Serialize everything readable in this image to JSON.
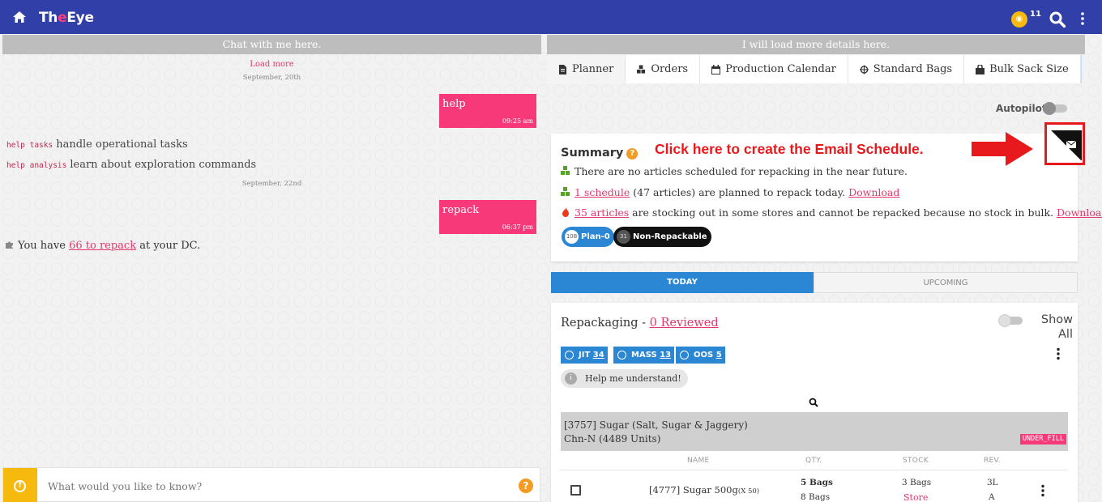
{
  "header": {
    "logo_pre": "Th",
    "logo_e": "e",
    "logo_post": "Eye",
    "coin_count": "11"
  },
  "chat": {
    "title": "Chat with me here.",
    "load_more": "Load more",
    "date1": "September, 20th",
    "msg1": {
      "text": "help",
      "time": "09:25 am"
    },
    "help_lines": [
      {
        "cmd": "help tasks",
        "desc": "handle operational tasks"
      },
      {
        "cmd": "help analysis",
        "desc": "learn about exploration commands"
      }
    ],
    "date2": "September, 22nd",
    "msg2": {
      "text": "repack",
      "time": "06:37 pm"
    },
    "repack_pre": "You have",
    "repack_link": "66 to repack",
    "repack_post": "at your DC.",
    "input_placeholder": "What would you like to know?"
  },
  "details": {
    "title": "I will load more details here.",
    "tabs": [
      "Planner",
      "Orders",
      "Production Calendar",
      "Standard Bags",
      "Bulk Sack Size"
    ],
    "autopilot_label": "Autopilot"
  },
  "summary": {
    "title": "Summary",
    "callout": "Click here to create the Email Schedule.",
    "line1": "There are no articles scheduled for repacking in the near future.",
    "line2_link": "1 schedule",
    "line2_text": "(47 articles) are planned to repack today.",
    "line2_download": "Download",
    "line3_link": "35 articles",
    "line3_text": "are stocking out in some stores and cannot be repacked because no stock in bulk.",
    "line3_download": "Download",
    "pill1": {
      "count": "108",
      "label": "Plan-0"
    },
    "pill2": {
      "count": "31",
      "label": "Non-Repackable"
    }
  },
  "day_tabs": [
    "TODAY",
    "UPCOMING"
  ],
  "repack": {
    "title": "Repackaging -",
    "reviewed": "0 Reviewed",
    "show_all_1": "Show",
    "show_all_2": "All",
    "badges": [
      {
        "label": "JIT",
        "count": "34"
      },
      {
        "label": "MASS",
        "count": "13"
      },
      {
        "label": "OOS",
        "count": "5"
      }
    ],
    "help_label": "Help me understand!",
    "group": {
      "line1": "[3757] Sugar (Salt, Sugar & Jaggery)",
      "line2": "Chn-N (4489 Units)",
      "tag": "UNDER_FILL"
    },
    "columns": [
      "NAME",
      "QTY.",
      "STOCK",
      "REV."
    ],
    "row": {
      "name": "[4777] Sugar 500g",
      "multiplier": "(X 50)",
      "qty1": "5 Bags",
      "qty2": "8 Bags",
      "stock1": "3 Bags",
      "stock2": "Store",
      "rev1": "3L",
      "rev2": "A"
    }
  },
  "colors": {
    "header_bg": "#3140a8",
    "accent_pink": "#f7397a",
    "primary_blue": "#2b86d4",
    "callout_red": "#e8191c",
    "coin_yellow": "#f6b90d"
  }
}
